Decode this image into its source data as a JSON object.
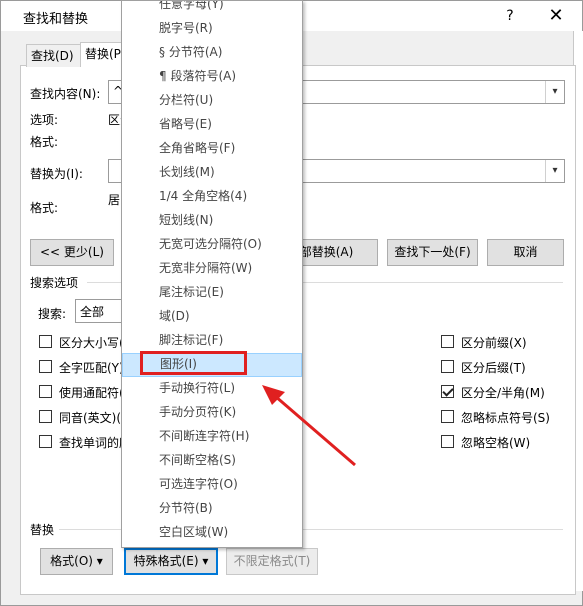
{
  "window": {
    "title": "查找和替换",
    "help": "?",
    "close": "✕"
  },
  "tabs": {
    "find": "查找(D)",
    "replace": "替换(P)"
  },
  "find": {
    "label": "查找内容(N):",
    "value": "^g"
  },
  "options": {
    "label": "选项:",
    "value": "区分全/半角"
  },
  "format_label": "格式:",
  "replace": {
    "label": "替换为(I):",
    "value": "",
    "format_label": "格式:",
    "format_value": "居中"
  },
  "buttons": {
    "less": "<< 更少(L)",
    "replace_all": "全部替换(A)",
    "find_next": "查找下一处(F)",
    "cancel": "取消"
  },
  "search_options": {
    "heading": "搜索选项",
    "search_label": "搜索:",
    "search_value": "全部"
  },
  "left_checks": [
    {
      "label": "区分大小写(H)",
      "checked": false
    },
    {
      "label": "全字匹配(Y)",
      "checked": false
    },
    {
      "label": "使用通配符(U)",
      "checked": false
    },
    {
      "label": "同音(英文)(K)",
      "checked": false
    },
    {
      "label": "查找单词的所有形式(英文)(W)",
      "checked": false
    }
  ],
  "right_checks": [
    {
      "label": "区分前缀(X)",
      "checked": false
    },
    {
      "label": "区分后缀(T)",
      "checked": false
    },
    {
      "label": "区分全/半角(M)",
      "checked": true
    },
    {
      "label": "忽略标点符号(S)",
      "checked": false
    },
    {
      "label": "忽略空格(W)",
      "checked": false
    }
  ],
  "replace_section": {
    "heading": "替换",
    "format_button": "格式(O) ▾",
    "special_button": "特殊格式(E) ▾",
    "no_format_button": "不限定格式(T)"
  },
  "menu": {
    "items": [
      "任意字母(Y)",
      "脱字号(R)",
      "§ 分节符(A)",
      "¶ 段落符号(A)",
      "分栏符(U)",
      "省略号(E)",
      "全角省略号(F)",
      "长划线(M)",
      "1/4 全角空格(4)",
      "短划线(N)",
      "无宽可选分隔符(O)",
      "无宽非分隔符(W)",
      "尾注标记(E)",
      "域(D)",
      "脚注标记(F)",
      "图形(I)",
      "手动换行符(L)",
      "手动分页符(K)",
      "不间断连字符(H)",
      "不间断空格(S)",
      "可选连字符(O)",
      "分节符(B)",
      "空白区域(W)"
    ],
    "highlighted_index": 15
  },
  "colors": {
    "highlight": "#cce8ff",
    "annotation": "#e02020",
    "special_button_border": "#0078d7"
  }
}
